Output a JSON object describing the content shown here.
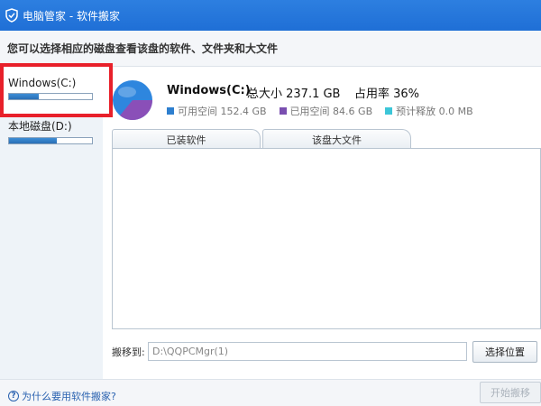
{
  "window": {
    "title": "电脑管家 - 软件搬家",
    "logo_icon": "shield-check-icon"
  },
  "subtitle": "您可以选择相应的磁盘查看该盘的软件、文件夹和大文件",
  "drives": [
    {
      "label": "Windows(C:)",
      "usage_fraction": 0.36,
      "selected": true
    },
    {
      "label": "本地磁盘(D:)",
      "usage_fraction": 0.58,
      "selected": false
    }
  ],
  "disk_summary": {
    "name": "Windows(C:)",
    "total": "总大小 237.1 GB",
    "usage": "占用率 36%",
    "pie": {
      "used_fraction": 0.36,
      "used_color": "#8a4fb8",
      "free_color": "#2e86de"
    },
    "legend": [
      {
        "label": "可用空间 152.4 GB",
        "color": "#2e7fcf"
      },
      {
        "label": "已用空间 84.6 GB",
        "color": "#7a4fb0"
      },
      {
        "label": "预计释放 0.0 MB",
        "color": "#3cc6d8"
      }
    ]
  },
  "tabs": [
    {
      "label": "已装软件",
      "active": true
    },
    {
      "label": "该盘大文件",
      "active": false
    }
  ],
  "move_to": {
    "label": "搬移到:",
    "path_value": "D:\\QQPCMgr(1)",
    "choose_button": "选择位置"
  },
  "footer": {
    "help_link": "为什么要用软件搬家?",
    "start_button": "开始搬移"
  }
}
